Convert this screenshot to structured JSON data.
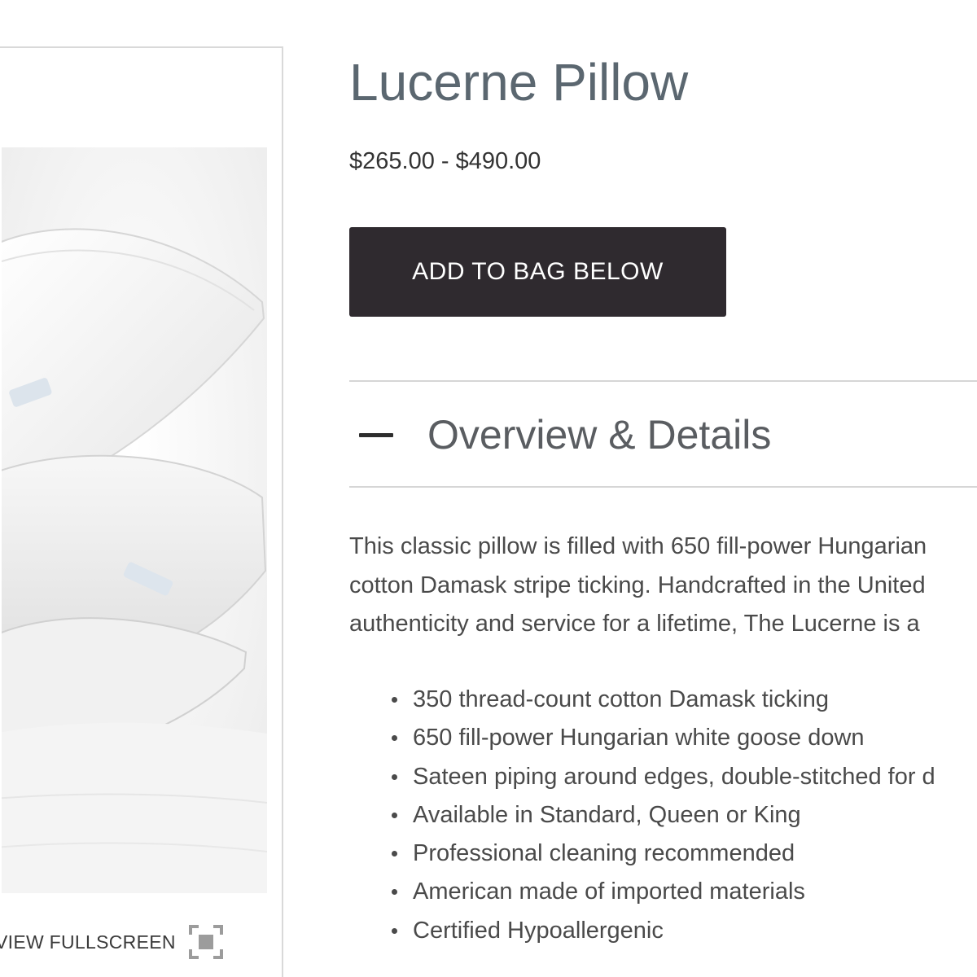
{
  "gallery": {
    "fullscreen_label": "VIEW FULLSCREEN",
    "fullscreen_icon": "fullscreen-icon"
  },
  "product": {
    "title": "Lucerne Pillow",
    "price": "$265.00 - $490.00",
    "add_to_bag_label": "ADD TO BAG BELOW"
  },
  "details": {
    "section_title": "Overview & Details",
    "toggle_icon": "minus-icon",
    "expanded": true,
    "description_lines": [
      "This classic pillow is filled with 650 fill-power Hungarian",
      "cotton Damask stripe ticking. Handcrafted in the United",
      "authenticity and service for a lifetime, The Lucerne is a"
    ],
    "features": [
      "350 thread-count cotton Damask ticking",
      "650 fill-power Hungarian white goose down",
      "Sateen piping around edges, double-stitched for d",
      "Available in Standard, Queen or King",
      "Professional cleaning recommended",
      "American made of imported materials",
      "Certified Hypoallergenic"
    ]
  },
  "colors": {
    "button_bg": "#2f2a2f",
    "title_color": "#5b6770",
    "text_color": "#4a4a4a",
    "divider": "#d6d6d6"
  }
}
